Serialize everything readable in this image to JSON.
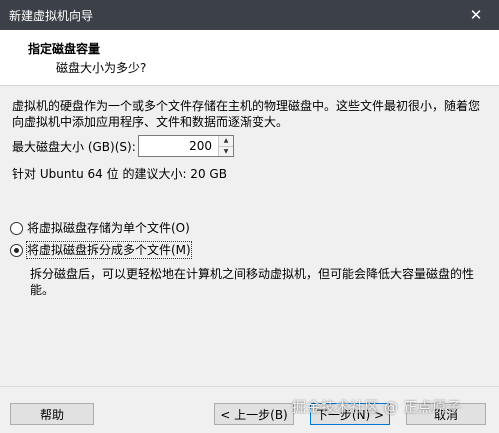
{
  "window": {
    "title": "新建虚拟机向导",
    "close_glyph": "✕"
  },
  "header": {
    "title": "指定磁盘容量",
    "subtitle": "磁盘大小为多少?"
  },
  "content": {
    "description_line1": "虚拟机的硬盘作为一个或多个文件存储在主机的物理磁盘中。这些文件最初很小，随着您",
    "description_line2": "向虚拟机中添加应用程序、文件和数据而逐渐变大。",
    "max_size_label": "最大磁盘大小 (GB)(S):",
    "max_size_value": "200",
    "recommend_text": "针对 Ubuntu 64 位 的建议大小: 20 GB",
    "options": [
      {
        "label": "将虚拟磁盘存储为单个文件(O)",
        "checked": false
      },
      {
        "label": "将虚拟磁盘拆分成多个文件(M)",
        "checked": true
      }
    ],
    "note_line1": "拆分磁盘后，可以更轻松地在计算机之间移动虚拟机，但可能会降低大容量磁盘的性",
    "note_line2": "能。"
  },
  "footer": {
    "help_label": "帮助",
    "back_label": "< 上一步(B)",
    "next_label": "下一步(N) >",
    "cancel_label": "取消"
  },
  "watermark": "掘金技术社区 @ 正点原子"
}
